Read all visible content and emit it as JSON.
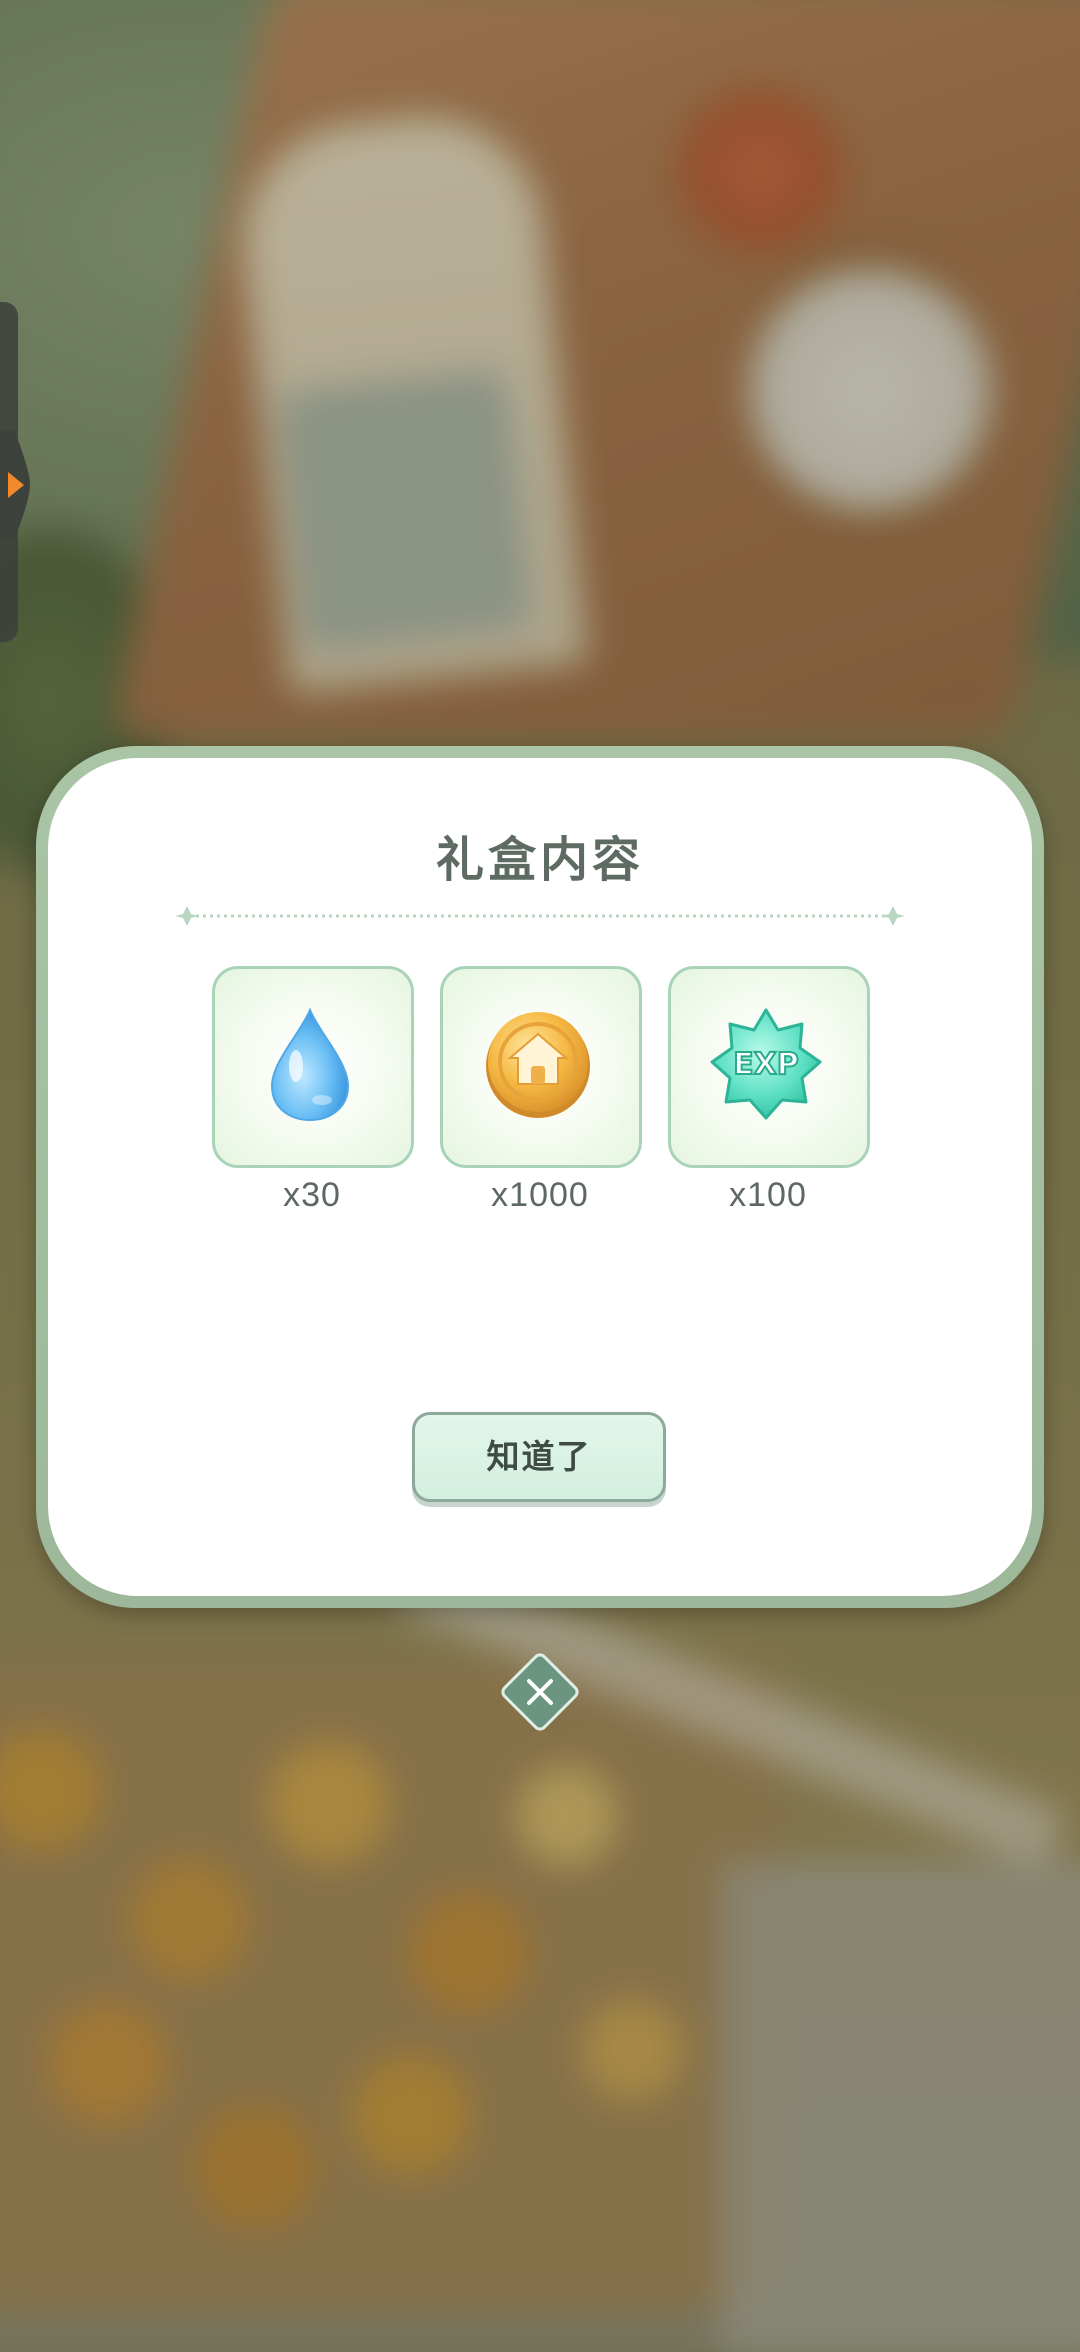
{
  "dialog": {
    "title": "礼盒内容",
    "confirm_label": "知道了"
  },
  "rewards": [
    {
      "icon": "water-drop-icon",
      "count": "x30"
    },
    {
      "icon": "house-coin-icon",
      "count": "x1000"
    },
    {
      "icon": "exp-star-icon",
      "exp_text": "EXP",
      "count": "x100"
    }
  ],
  "icons": {
    "close": "close-icon",
    "side_arrow": "arrow-right-icon"
  },
  "colors": {
    "accent_green": "#a8d3b8",
    "button_bg": "#d3efe0",
    "title_text": "#5d6b63",
    "side_arrow": "#f28a2a"
  }
}
